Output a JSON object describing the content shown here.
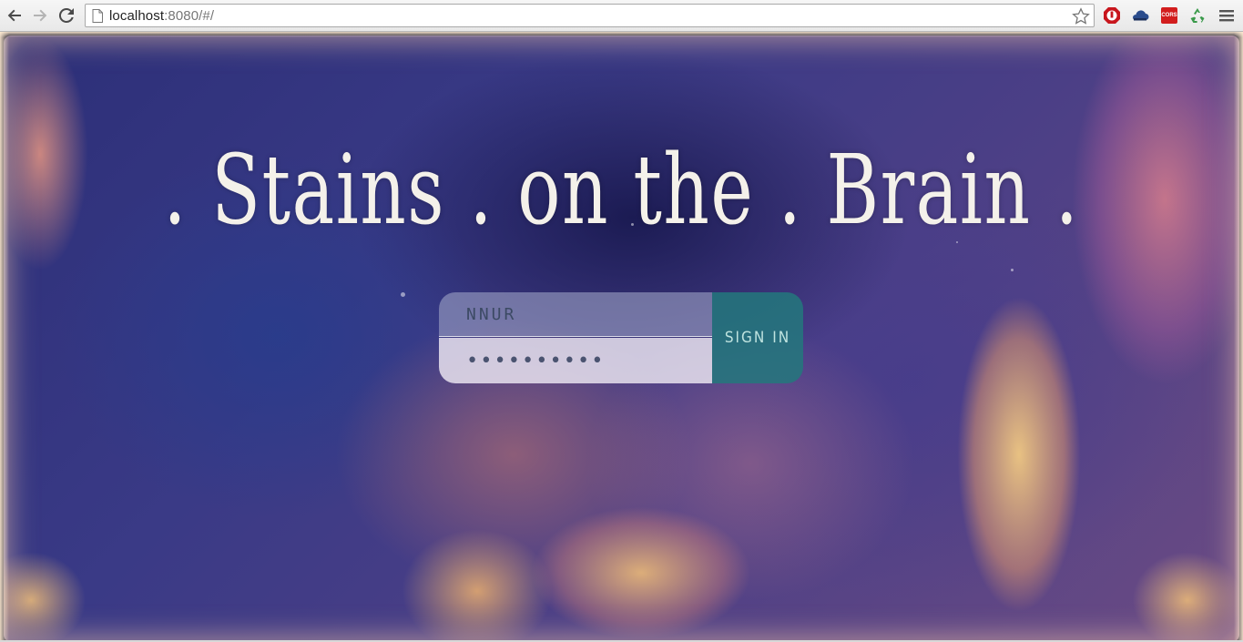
{
  "browser": {
    "url_host": "localhost",
    "url_rest": ":8080/#/",
    "icons": {
      "back": "back-arrow-icon",
      "forward": "forward-arrow-icon",
      "reload": "reload-icon",
      "page": "page-icon",
      "bookmark": "star-icon",
      "menu": "hamburger-menu-icon"
    },
    "extensions": [
      {
        "name": "adblock-icon"
      },
      {
        "name": "cloud-icon"
      },
      {
        "name": "cors-icon",
        "label": "CORS"
      },
      {
        "name": "recycle-icon"
      }
    ]
  },
  "page": {
    "title": ". Stains . on the . Brain .",
    "colors": {
      "title": "#f4f1ea",
      "signin_bg": "#23787d",
      "field_text": "#3c4a64"
    }
  },
  "login": {
    "username_value": "NNUR",
    "password_mask": "••••••••••",
    "submit_label": "SIGN IN"
  }
}
